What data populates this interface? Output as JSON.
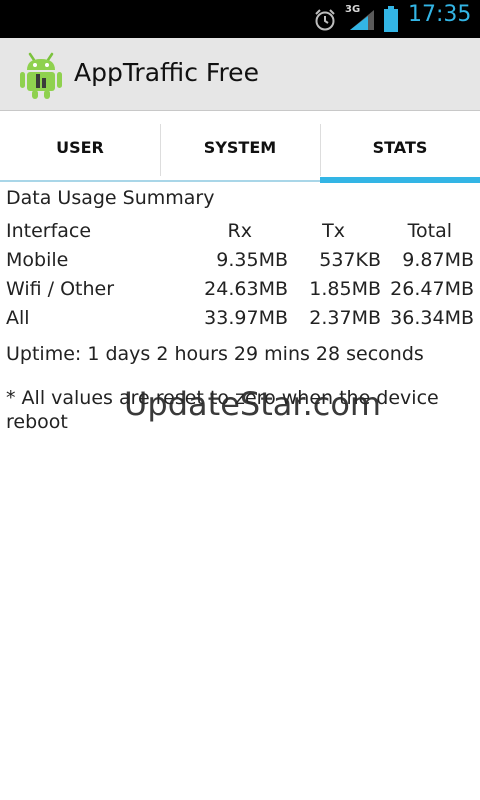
{
  "status_bar": {
    "network_type": "3G",
    "time": "17:35",
    "accent_color": "#33b5e5",
    "icons": [
      "alarm-icon",
      "signal-icon",
      "battery-icon"
    ]
  },
  "action_bar": {
    "title": "AppTraffic Free",
    "icon": "android-app-icon"
  },
  "tabs": [
    {
      "label": "USER",
      "active": false
    },
    {
      "label": "SYSTEM",
      "active": false
    },
    {
      "label": "STATS",
      "active": true
    }
  ],
  "stats": {
    "title": "Data Usage Summary",
    "columns": [
      "Interface",
      "Rx",
      "Tx",
      "Total"
    ],
    "rows": [
      {
        "interface": "Mobile",
        "rx": "9.35MB",
        "tx": "537KB",
        "total": "9.87MB"
      },
      {
        "interface": "Wifi / Other",
        "rx": "24.63MB",
        "tx": "1.85MB",
        "total": "26.47MB"
      },
      {
        "interface": "All",
        "rx": "33.97MB",
        "tx": "2.37MB",
        "total": "36.34MB"
      }
    ],
    "uptime": "Uptime: 1 days 2 hours 29 mins 28 seconds",
    "note": "* All values are reset to zero when the device reboot"
  },
  "watermark": "UpdateStar.com"
}
